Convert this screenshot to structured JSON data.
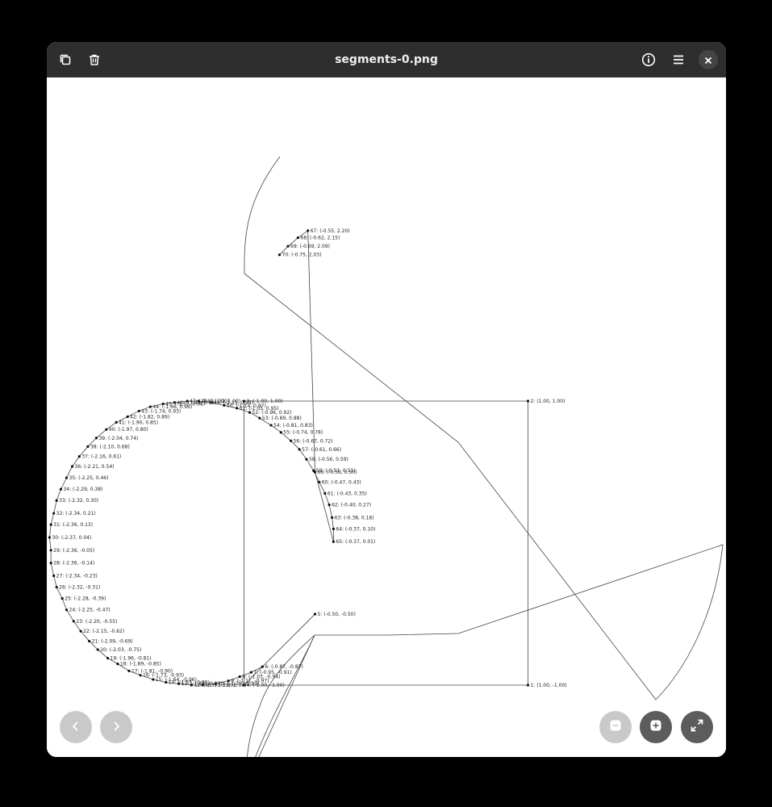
{
  "window": {
    "title": "segments-0.png",
    "icons": {
      "copy": "copy-icon",
      "delete": "trash-icon",
      "info": "info-icon",
      "menu": "hamburger-menu-icon",
      "close": "close-icon",
      "prev": "chevron-left-icon",
      "next": "chevron-right-icon",
      "zoom_out": "zoom-out-icon",
      "zoom_in": "zoom-in-icon",
      "fullscreen": "fullscreen-icon"
    }
  },
  "plot": {
    "points": [
      {
        "label": "1: (1.00, -1.00)",
        "x": 1.0,
        "y": -1.0
      },
      {
        "label": "2: (1.00, 1.00)",
        "x": 1.0,
        "y": 1.0
      },
      {
        "label": "3: (-1.00, 1.00)",
        "x": -1.0,
        "y": 1.0
      },
      {
        "label": "4: (-1.00, -1.00)",
        "x": -1.0,
        "y": -1.0
      },
      {
        "label": "5: (-0.50, -0.50)",
        "x": -0.5,
        "y": -0.5
      },
      {
        "label": "6: (-0.87, -0.87)",
        "x": -0.87,
        "y": -0.87
      },
      {
        "label": "7: (-0.95, -0.91)",
        "x": -0.95,
        "y": -0.91
      },
      {
        "label": "8: (-1.03, -0.94)",
        "x": -1.03,
        "y": -0.94
      },
      {
        "label": "9: (-1.11, -0.97)",
        "x": -1.11,
        "y": -0.97
      },
      {
        "label": "10: (-1.20, -0.99)",
        "x": -1.2,
        "y": -0.99
      },
      {
        "label": "11: (-1.29, -1.00)",
        "x": -1.29,
        "y": -1.0
      },
      {
        "label": "12: (-1.37, -1.00)",
        "x": -1.37,
        "y": -1.0
      },
      {
        "label": "13: (-1.46, -0.99)",
        "x": -1.46,
        "y": -0.99
      },
      {
        "label": "14: (-1.55, -0.98)",
        "x": -1.55,
        "y": -0.98
      },
      {
        "label": "15: (-1.64, -0.96)",
        "x": -1.64,
        "y": -0.96
      },
      {
        "label": "16: (-1.73, -0.93)",
        "x": -1.73,
        "y": -0.93
      },
      {
        "label": "17: (-1.81, -0.90)",
        "x": -1.81,
        "y": -0.9
      },
      {
        "label": "18: (-1.89, -0.85)",
        "x": -1.89,
        "y": -0.85
      },
      {
        "label": "19: (-1.96, -0.81)",
        "x": -1.96,
        "y": -0.81
      },
      {
        "label": "20: (-2.03, -0.75)",
        "x": -2.03,
        "y": -0.75
      },
      {
        "label": "21: (-2.09, -0.69)",
        "x": -2.09,
        "y": -0.69
      },
      {
        "label": "22: (-2.15, -0.62)",
        "x": -2.15,
        "y": -0.62
      },
      {
        "label": "23: (-2.20, -0.55)",
        "x": -2.2,
        "y": -0.55
      },
      {
        "label": "24: (-2.25, -0.47)",
        "x": -2.25,
        "y": -0.47
      },
      {
        "label": "25: (-2.28, -0.39)",
        "x": -2.28,
        "y": -0.39
      },
      {
        "label": "26: (-2.32, -0.31)",
        "x": -2.32,
        "y": -0.31
      },
      {
        "label": "27: (-2.34, -0.23)",
        "x": -2.34,
        "y": -0.23
      },
      {
        "label": "28: (-2.36, -0.14)",
        "x": -2.36,
        "y": -0.14
      },
      {
        "label": "29: (-2.36, -0.05)",
        "x": -2.36,
        "y": -0.05
      },
      {
        "label": "30: (-2.37, 0.04)",
        "x": -2.37,
        "y": 0.04
      },
      {
        "label": "31: (-2.36, 0.13)",
        "x": -2.36,
        "y": 0.13
      },
      {
        "label": "32: (-2.34, 0.21)",
        "x": -2.34,
        "y": 0.21
      },
      {
        "label": "33: (-2.32, 0.30)",
        "x": -2.32,
        "y": 0.3
      },
      {
        "label": "34: (-2.29, 0.38)",
        "x": -2.29,
        "y": 0.38
      },
      {
        "label": "35: (-2.25, 0.46)",
        "x": -2.25,
        "y": 0.46
      },
      {
        "label": "36: (-2.21, 0.54)",
        "x": -2.21,
        "y": 0.54
      },
      {
        "label": "37: (-2.16, 0.61)",
        "x": -2.16,
        "y": 0.61
      },
      {
        "label": "38: (-2.10, 0.68)",
        "x": -2.1,
        "y": 0.68
      },
      {
        "label": "39: (-2.04, 0.74)",
        "x": -2.04,
        "y": 0.74
      },
      {
        "label": "40: (-1.97, 0.80)",
        "x": -1.97,
        "y": 0.8
      },
      {
        "label": "41: (-1.90, 0.85)",
        "x": -1.9,
        "y": 0.85
      },
      {
        "label": "42: (-1.82, 0.89)",
        "x": -1.82,
        "y": 0.89
      },
      {
        "label": "43: (-1.74, 0.93)",
        "x": -1.74,
        "y": 0.93
      },
      {
        "label": "44: (-1.66, 0.96)",
        "x": -1.66,
        "y": 0.96
      },
      {
        "label": "45: (-1.57, 0.98)",
        "x": -1.57,
        "y": 0.98
      },
      {
        "label": "46: (-1.49, 0.99)",
        "x": -1.49,
        "y": 0.99
      },
      {
        "label": "47: (-1.40, 1.00)",
        "x": -1.4,
        "y": 1.0
      },
      {
        "label": "48: (-1.32, 1.00)",
        "x": -1.32,
        "y": 1.0
      },
      {
        "label": "49: (-1.23, 0.99)",
        "x": -1.23,
        "y": 0.99
      },
      {
        "label": "50: (-1.14, 0.97)",
        "x": -1.14,
        "y": 0.97
      },
      {
        "label": "51: (-1.05, 0.95)",
        "x": -1.05,
        "y": 0.95
      },
      {
        "label": "52: (-0.96, 0.92)",
        "x": -0.96,
        "y": 0.92
      },
      {
        "label": "53: (-0.89, 0.88)",
        "x": -0.89,
        "y": 0.88
      },
      {
        "label": "54: (-0.81, 0.83)",
        "x": -0.81,
        "y": 0.83
      },
      {
        "label": "55: (-0.74, 0.78)",
        "x": -0.74,
        "y": 0.78
      },
      {
        "label": "56: (-0.67, 0.72)",
        "x": -0.67,
        "y": 0.72
      },
      {
        "label": "57: (-0.61, 0.66)",
        "x": -0.61,
        "y": 0.66
      },
      {
        "label": "58: (-0.56, 0.59)",
        "x": -0.56,
        "y": 0.59
      },
      {
        "label": "59: (-0.51, 0.51)",
        "x": -0.51,
        "y": 0.51
      },
      {
        "label": "60: (-0.47, 0.43)",
        "x": -0.47,
        "y": 0.43
      },
      {
        "label": "61: (-0.43, 0.35)",
        "x": -0.43,
        "y": 0.35
      },
      {
        "label": "62: (-0.40, 0.27)",
        "x": -0.4,
        "y": 0.27
      },
      {
        "label": "63: (-0.38, 0.18)",
        "x": -0.38,
        "y": 0.18
      },
      {
        "label": "64: (-0.37, 0.10)",
        "x": -0.37,
        "y": 0.1
      },
      {
        "label": "65: (-0.37, 0.01)",
        "x": -0.37,
        "y": 0.01
      },
      {
        "label": "66: (-0.50, 0.50)",
        "x": -0.5,
        "y": 0.5
      },
      {
        "label": "67: (-0.55, 2.20)",
        "x": -0.55,
        "y": 2.2
      },
      {
        "label": "68: (-0.62, 2.15)",
        "x": -0.62,
        "y": 2.15
      },
      {
        "label": "69: (-0.69, 2.09)",
        "x": -0.69,
        "y": 2.09
      },
      {
        "label": "70: (-0.75, 2.03)",
        "x": -0.75,
        "y": 2.03
      }
    ]
  }
}
